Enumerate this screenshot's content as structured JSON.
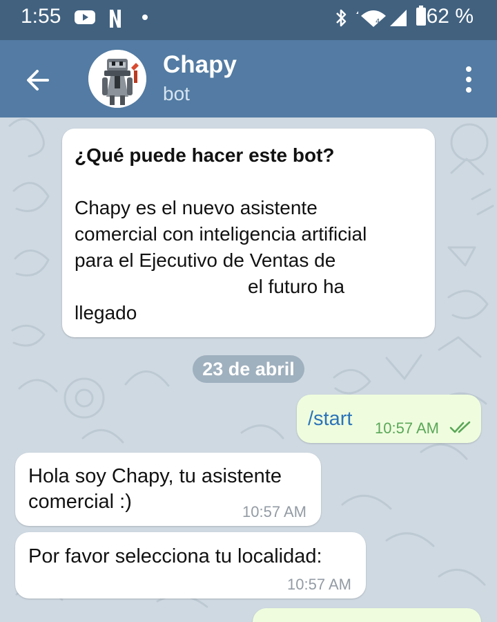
{
  "status_bar": {
    "time": "1:55",
    "battery": "62 %",
    "icons": [
      "youtube-icon",
      "netflix-icon",
      "dot-icon",
      "bluetooth-icon",
      "wifi-icon",
      "signal-icon",
      "battery-icon"
    ]
  },
  "header": {
    "title": "Chapy",
    "subtitle": "bot",
    "back_icon": "arrow-left-icon",
    "menu_icon": "more-vertical-icon"
  },
  "chat": {
    "info_card": {
      "title": "¿Qué puede hacer este bot?",
      "lines": [
        "Chapy es el nuevo asistente",
        "comercial con inteligencia artificial",
        "para el Ejecutivo de Ventas de",
        "el futuro ha",
        "llegado"
      ]
    },
    "date_separator": "23 de abril",
    "messages": [
      {
        "direction": "outgoing",
        "text": "/start",
        "time": "10:57 AM",
        "status": "read"
      },
      {
        "direction": "incoming",
        "lines": [
          "Hola soy Chapy, tu asistente",
          "comercial :)"
        ],
        "time": "10:57 AM"
      },
      {
        "direction": "incoming",
        "lines": [
          "Por favor selecciona tu localidad:"
        ],
        "time": "10:57 AM"
      }
    ]
  },
  "colors": {
    "status_bar": "#41617f",
    "header": "#537ba3",
    "chat_background": "#cfd9e2",
    "outgoing_bubble": "#effdde",
    "incoming_bubble": "#ffffff",
    "read_check": "#5aa758"
  }
}
